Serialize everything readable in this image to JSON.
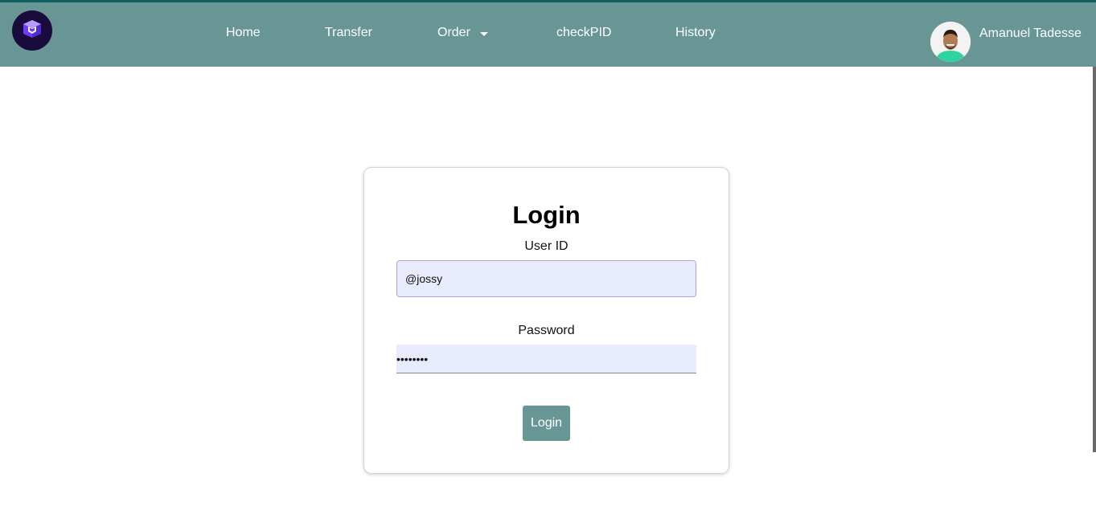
{
  "nav": {
    "logo_icon": "purple-cube-logo",
    "links": [
      {
        "label": "Home"
      },
      {
        "label": "Transfer"
      },
      {
        "label": "Order"
      },
      {
        "label": "checkPID"
      },
      {
        "label": "History"
      }
    ],
    "user": {
      "name": "Amanuel Tadesse"
    }
  },
  "login": {
    "title": "Login",
    "userid_label": "User ID",
    "userid_value": "@jossy",
    "password_label": "Password",
    "password_value": "password",
    "button_label": "Login"
  },
  "colors": {
    "navbar_bg": "#679694",
    "navbar_border": "#0f5f5f",
    "logo_bg": "#1a0b3d",
    "logo_accent": "#8b5cf6",
    "input_bg": "#e8eafd",
    "button_bg": "#679694"
  }
}
